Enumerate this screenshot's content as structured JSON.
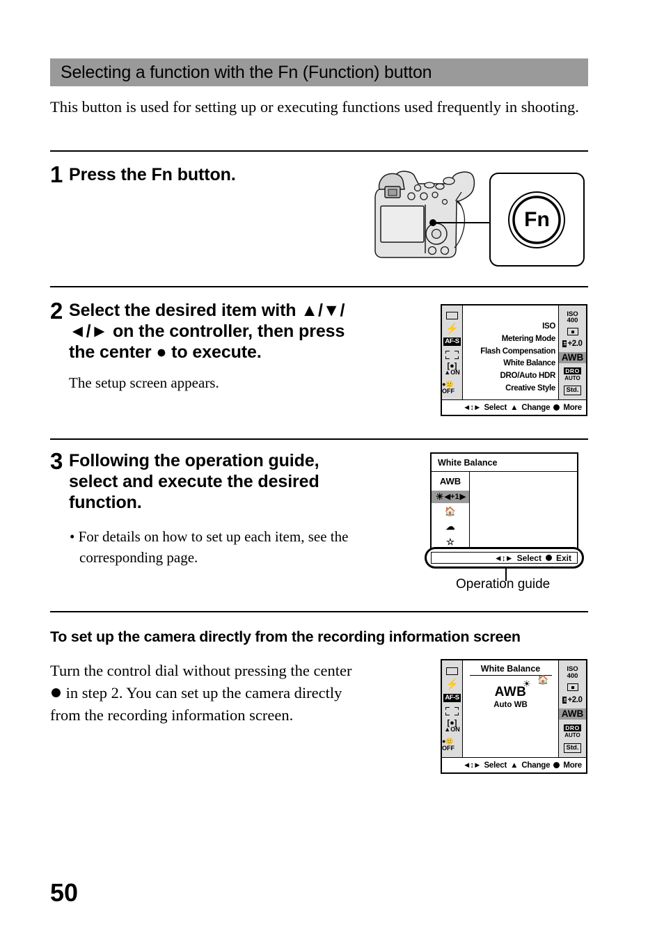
{
  "header": {
    "title": "Selecting a function with the Fn (Function) button"
  },
  "intro": "This button is used for setting up or executing functions used frequently in shooting.",
  "steps": [
    {
      "num": "1",
      "heading": "Press the Fn button.",
      "sub": "",
      "callout_label": "Fn"
    },
    {
      "num": "2",
      "heading": "Select the desired item with ▲/▼/◄/► on the controller, then press the center ● to execute.",
      "sub": "The setup screen appears."
    },
    {
      "num": "3",
      "heading": "Following the operation guide, select and execute the desired function.",
      "bullets": [
        "For details on how to set up each item, see the corresponding page."
      ]
    }
  ],
  "rec_info_screen": {
    "left_icons": [
      {
        "name": "drive-mode-icon",
        "label": ""
      },
      {
        "name": "flash-mode-icon",
        "label": "⚡"
      },
      {
        "name": "af-mode-icon",
        "label": "AF-S"
      },
      {
        "name": "af-area-icon",
        "label": ""
      },
      {
        "name": "steadyshot-icon",
        "label": "ON"
      },
      {
        "name": "face-detection-icon",
        "label": "OFF"
      }
    ],
    "menu_items": [
      "ISO",
      "Metering Mode",
      "Flash Compensation",
      "White Balance",
      "DRO/Auto HDR",
      "Creative Style"
    ],
    "values": {
      "iso": "ISO\n400",
      "iso_line1": "ISO",
      "iso_line2": "400",
      "metering": "spot-metering-icon",
      "flash_comp": "+2.0",
      "flash_comp_badge": "±",
      "white_balance": "AWB",
      "dro_badge": "DRO",
      "dro_mode": "AUTO",
      "creative_style": "Std."
    },
    "guide": {
      "nav": "◄↕►",
      "select": "Select",
      "dial": "▲",
      "change": "Change",
      "more": "More"
    }
  },
  "wb_setup_screen": {
    "title": "White Balance",
    "items": [
      {
        "label": "AWB",
        "selected": false
      },
      {
        "label": "+1",
        "selected": true,
        "icon": "daylight-sun-icon"
      },
      {
        "label": "",
        "selected": false,
        "icon": "shade-icon"
      },
      {
        "label": "",
        "selected": false,
        "icon": "cloudy-icon"
      },
      {
        "label": "",
        "selected": false,
        "icon": "incandescent-icon"
      }
    ],
    "guide": {
      "nav": "◄↕►",
      "select": "Select",
      "exit": "Exit"
    },
    "caption": "Operation guide"
  },
  "direct_section": {
    "heading": "To set up the camera directly from the recording information screen",
    "paragraph_part1": "Turn the control dial without pressing the center ",
    "paragraph_part2": " in step 2. You can set up the camera directly from the recording information screen.",
    "screen": {
      "title": "White Balance",
      "big_value": "AWB",
      "sub_value": "Auto WB"
    }
  },
  "page_number": "50",
  "colors": {
    "header_bar": "#9a9a9a",
    "lcd_panel": "#dcdcdc",
    "highlight": "#9a9a9a",
    "text": "#000000"
  }
}
